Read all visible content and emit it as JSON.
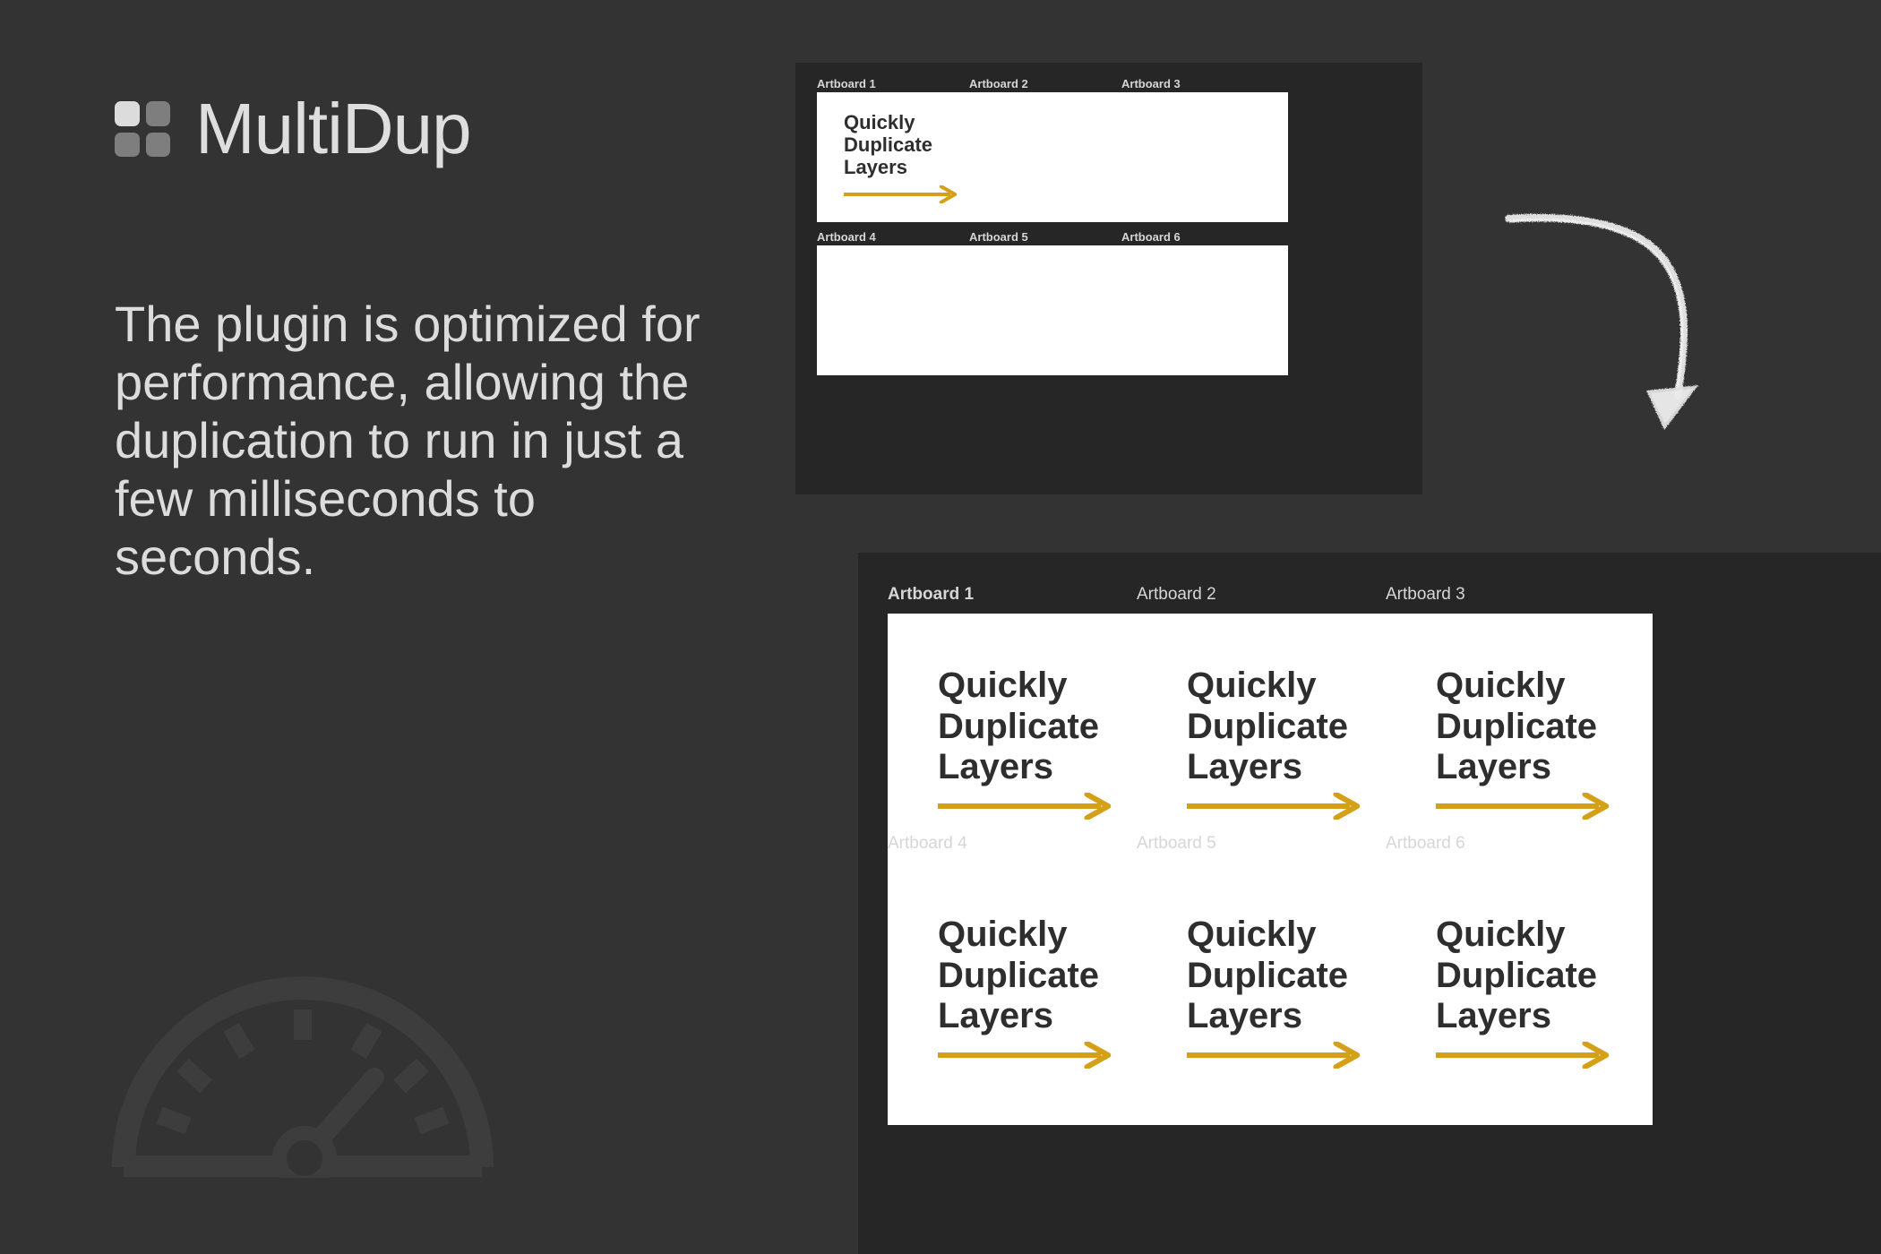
{
  "brand": {
    "title": "MultiDup",
    "logo_icon": "grid-2x2-icon",
    "logo_colors": {
      "active": "#dcdcdc",
      "inactive": "#7e7e7e"
    }
  },
  "intro": {
    "paragraph": "The plugin is optimized for performance, allowing the duplication to run in just a few milliseconds to seconds."
  },
  "decor": {
    "gauge_icon": "speedometer-icon",
    "gauge_color": "#3d3d3d",
    "sketch_arrow_icon": "curved-sketch-arrow-icon",
    "sketch_arrow_color": "#e8e8e8"
  },
  "theme": {
    "page_background": "#333333",
    "panel_background": "#262626",
    "artboard_background": "#ffffff",
    "accent": "#d4a017",
    "headline_color": "#2e2e2e",
    "label_color": "#d6d6d6",
    "body_text_color": "#dcdcdc"
  },
  "artboard_content": {
    "headline": "Quickly\nDuplicate\nLayers",
    "arrow_icon": "arrow-right-icon"
  },
  "panels": [
    {
      "id": "source",
      "name": "source-artboards-panel",
      "artboards": [
        {
          "label": "Artboard 1",
          "label_bold": true,
          "has_content": true
        },
        {
          "label": "Artboard 2",
          "label_bold": false,
          "has_content": false
        },
        {
          "label": "Artboard 3",
          "label_bold": false,
          "has_content": false
        },
        {
          "label": "Artboard 4",
          "label_bold": false,
          "has_content": false
        },
        {
          "label": "Artboard 5",
          "label_bold": false,
          "has_content": false
        },
        {
          "label": "Artboard 6",
          "label_bold": false,
          "has_content": false
        }
      ]
    },
    {
      "id": "result",
      "name": "duplicated-artboards-panel",
      "artboards": [
        {
          "label": "Artboard 1",
          "label_bold": true,
          "has_content": true
        },
        {
          "label": "Artboard 2",
          "label_bold": false,
          "has_content": true
        },
        {
          "label": "Artboard 3",
          "label_bold": false,
          "has_content": true
        },
        {
          "label": "Artboard 4",
          "label_bold": false,
          "has_content": true
        },
        {
          "label": "Artboard 5",
          "label_bold": false,
          "has_content": true
        },
        {
          "label": "Artboard 6",
          "label_bold": false,
          "has_content": true
        }
      ]
    }
  ]
}
